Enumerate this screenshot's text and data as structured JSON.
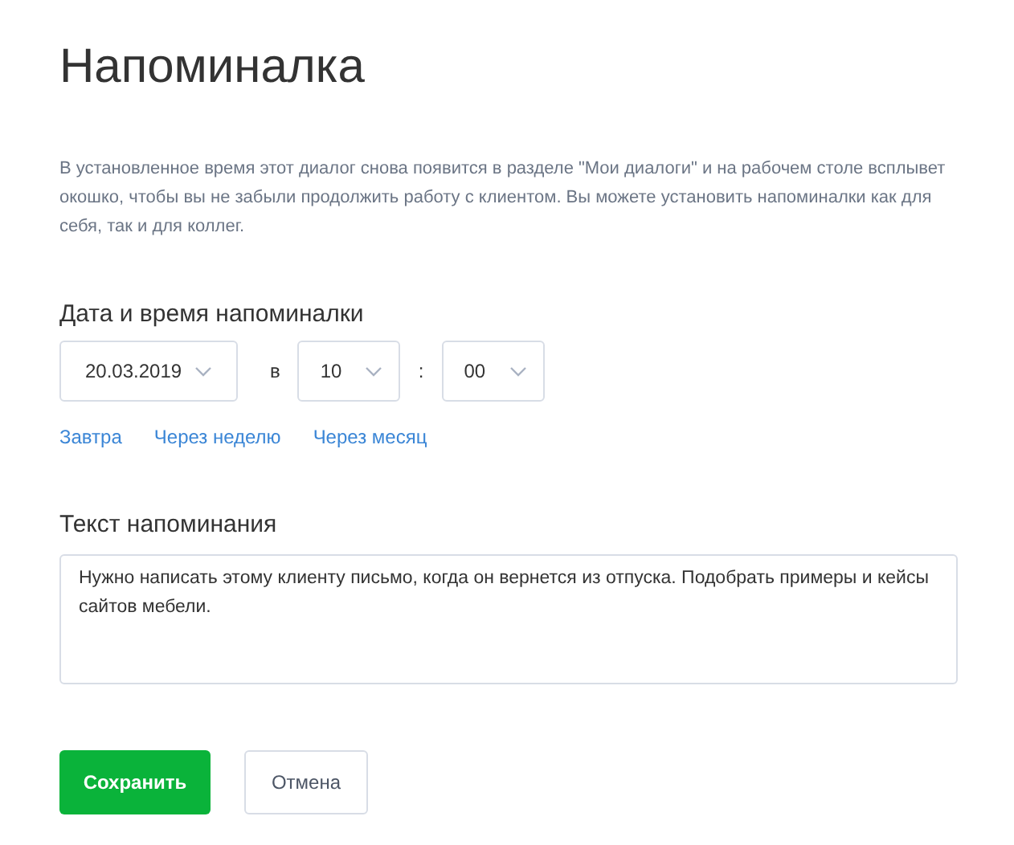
{
  "title": "Напоминалка",
  "description": "В установленное время этот диалог снова появится в разделе \"Мои диалоги\" и на рабочем столе всплывет окошко, чтобы вы не забыли продолжить работу с клиентом. Вы можете установить напоминалки как для себя, так и для коллег.",
  "datetime": {
    "label": "Дата и время напоминалки",
    "date": "20.03.2019",
    "at": "в",
    "hour": "10",
    "separator": ":",
    "minute": "00"
  },
  "quick_links": [
    "Завтра",
    "Через неделю",
    "Через месяц"
  ],
  "reminder": {
    "label": "Текст напоминания",
    "value": "Нужно написать этому клиенту письмо, когда он вернется из отпуска. Подобрать примеры и кейсы сайтов мебели."
  },
  "buttons": [
    {
      "label": "Сохранить",
      "kind": "primary"
    },
    {
      "label": "Отмена",
      "kind": "secondary"
    }
  ]
}
